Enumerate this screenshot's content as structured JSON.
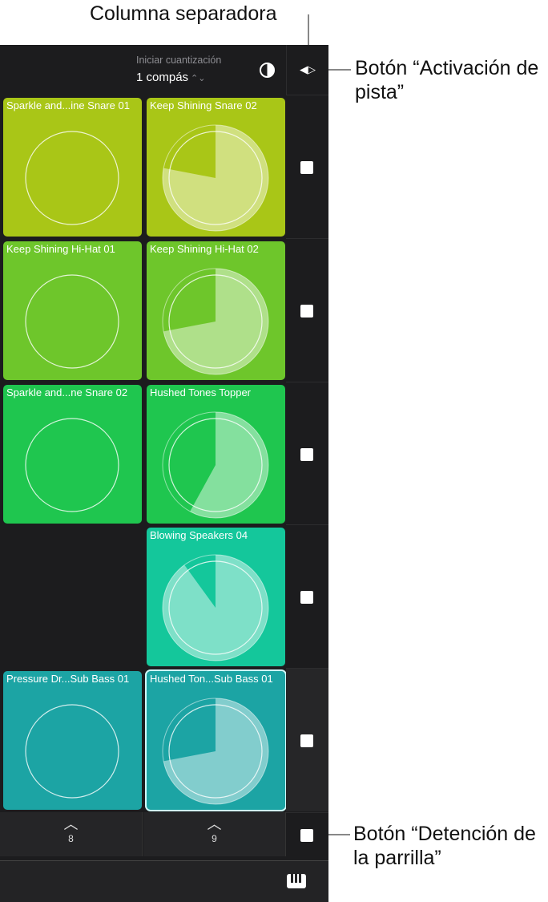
{
  "callouts": {
    "separator": "Columna separadora",
    "track_activation": "Botón “Activación de pista”",
    "grid_stop": "Botón “Detención de la parrilla”"
  },
  "header": {
    "quantize_label": "Iniciar cuantización",
    "quantize_value": "1 compás",
    "contrast_icon": "contrast-icon",
    "separator_icon": "triangle-left-right-icon"
  },
  "grid": {
    "rows": [
      {
        "color": "#a9c617",
        "cells": [
          {
            "name": "Sparkle and...ine Snare 01",
            "playing": false
          },
          {
            "name": "Keep Shining Snare 02",
            "playing": true,
            "progress": 0.78
          }
        ]
      },
      {
        "color": "#6ec62b",
        "cells": [
          {
            "name": "Keep Shining Hi-Hat 01",
            "playing": false
          },
          {
            "name": "Keep Shining Hi-Hat 02",
            "playing": true,
            "progress": 0.72
          }
        ]
      },
      {
        "color": "#1fc64f",
        "cells": [
          {
            "name": "Sparkle and...ne Snare 02",
            "playing": false
          },
          {
            "name": "Hushed Tones Topper",
            "playing": true,
            "progress": 0.58
          }
        ]
      },
      {
        "color": "#14c79b",
        "cells": [
          null,
          {
            "name": "Blowing Speakers 04",
            "playing": true,
            "progress": 0.9
          }
        ]
      },
      {
        "color": "#1ca4a4",
        "cells": [
          {
            "name": "Pressure Dr...Sub Bass 01",
            "playing": false
          },
          {
            "name": "Hushed Ton...Sub Bass 01",
            "playing": true,
            "progress": 0.72,
            "selected": true
          }
        ]
      }
    ]
  },
  "footer": {
    "columns": [
      {
        "label": "8"
      },
      {
        "label": "9"
      }
    ]
  },
  "toolbar": {
    "keyboard_icon": "piano-keys-icon"
  }
}
